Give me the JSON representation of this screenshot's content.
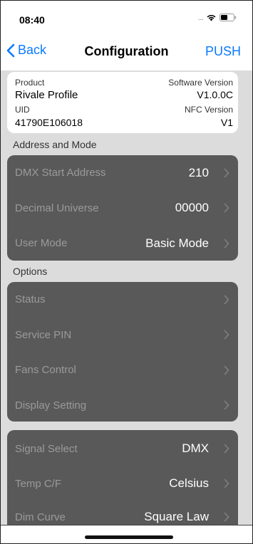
{
  "status_bar": {
    "time": "08:40",
    "signal_dots": "....."
  },
  "nav": {
    "back_label": "Back",
    "title": "Configuration",
    "push_label": "PUSH",
    "accent_color": "#0a7aff"
  },
  "info": {
    "product_label": "Product",
    "product_value": "Rivale Profile",
    "software_version_label": "Software Version",
    "software_version_value": "V1.0.0C",
    "uid_label": "UID",
    "uid_value": "41790E106018",
    "nfc_version_label": "NFC Version",
    "nfc_version_value": "V1"
  },
  "sections": {
    "address_mode_header": "Address and Mode",
    "options_header": "Options"
  },
  "address_mode": [
    {
      "label": "DMX Start Address",
      "value": "210"
    },
    {
      "label": "Decimal Universe",
      "value": "00000"
    },
    {
      "label": "User Mode",
      "value": "Basic Mode"
    }
  ],
  "options": [
    {
      "label": "Status"
    },
    {
      "label": "Service PIN"
    },
    {
      "label": "Fans Control"
    },
    {
      "label": "Display Setting"
    }
  ],
  "settings": [
    {
      "label": "Signal Select",
      "value": "DMX"
    },
    {
      "label": "Temp C/F",
      "value": "Celsius"
    },
    {
      "label": "Dim Curve",
      "value": "Square Law"
    }
  ]
}
